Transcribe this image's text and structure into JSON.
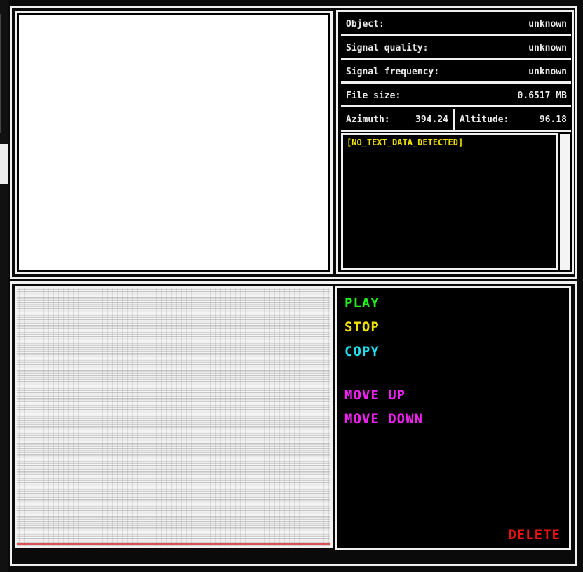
{
  "info": {
    "object": {
      "label": "Object:",
      "value": "unknown"
    },
    "signal_quality": {
      "label": "Signal quality:",
      "value": "unknown"
    },
    "signal_frequency": {
      "label": "Signal frequency:",
      "value": "unknown"
    },
    "file_size": {
      "label": "File size:",
      "value": "0.6517 MB"
    },
    "azimuth": {
      "label": "Azimuth:",
      "value": "394.24"
    },
    "altitude": {
      "label": "Altitude:",
      "value": "96.18"
    },
    "text_data": "[NO_TEXT_DATA_DETECTED]"
  },
  "controls": {
    "play": "PLAY",
    "stop": "STOP",
    "copy": "COPY",
    "move_up": "MOVE UP",
    "move_down": "MOVE DOWN",
    "delete": "DELETE"
  },
  "colors": {
    "play": "#22ee22",
    "stop": "#f0e000",
    "copy": "#22ddee",
    "move": "#ee22ee",
    "delete": "#ee1111",
    "text_data": "#f0e000"
  }
}
